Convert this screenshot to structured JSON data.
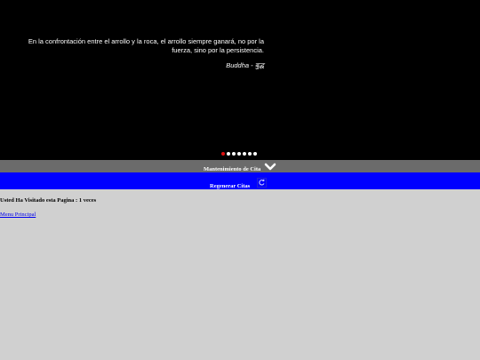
{
  "slider": {
    "quote_line1": "En la confrontación entre el arrollo y la roca, el arrollo siempre ganará, no por la",
    "quote_line2": "fuerza, sino por la persistencia.",
    "author": "Buddha - बुद्ध",
    "dot_count": 7,
    "active_dot": 1
  },
  "maintenance_bar": {
    "label": "Mantenimiento de Cita",
    "icon": "chevron-down-icon",
    "background": "#6b6b6b"
  },
  "regenerate_bar": {
    "label": "Regenerar Citas",
    "icon": "reload-icon",
    "background": "#0000ff"
  },
  "visits": {
    "text": "Usted Ha Visitado esta Pagina : 1 veces"
  },
  "menu": {
    "link_label": "Menu Principal"
  },
  "colors": {
    "hero_background": "#000000",
    "page_background": "#d0d0d0",
    "active_dot": "#e01010"
  }
}
